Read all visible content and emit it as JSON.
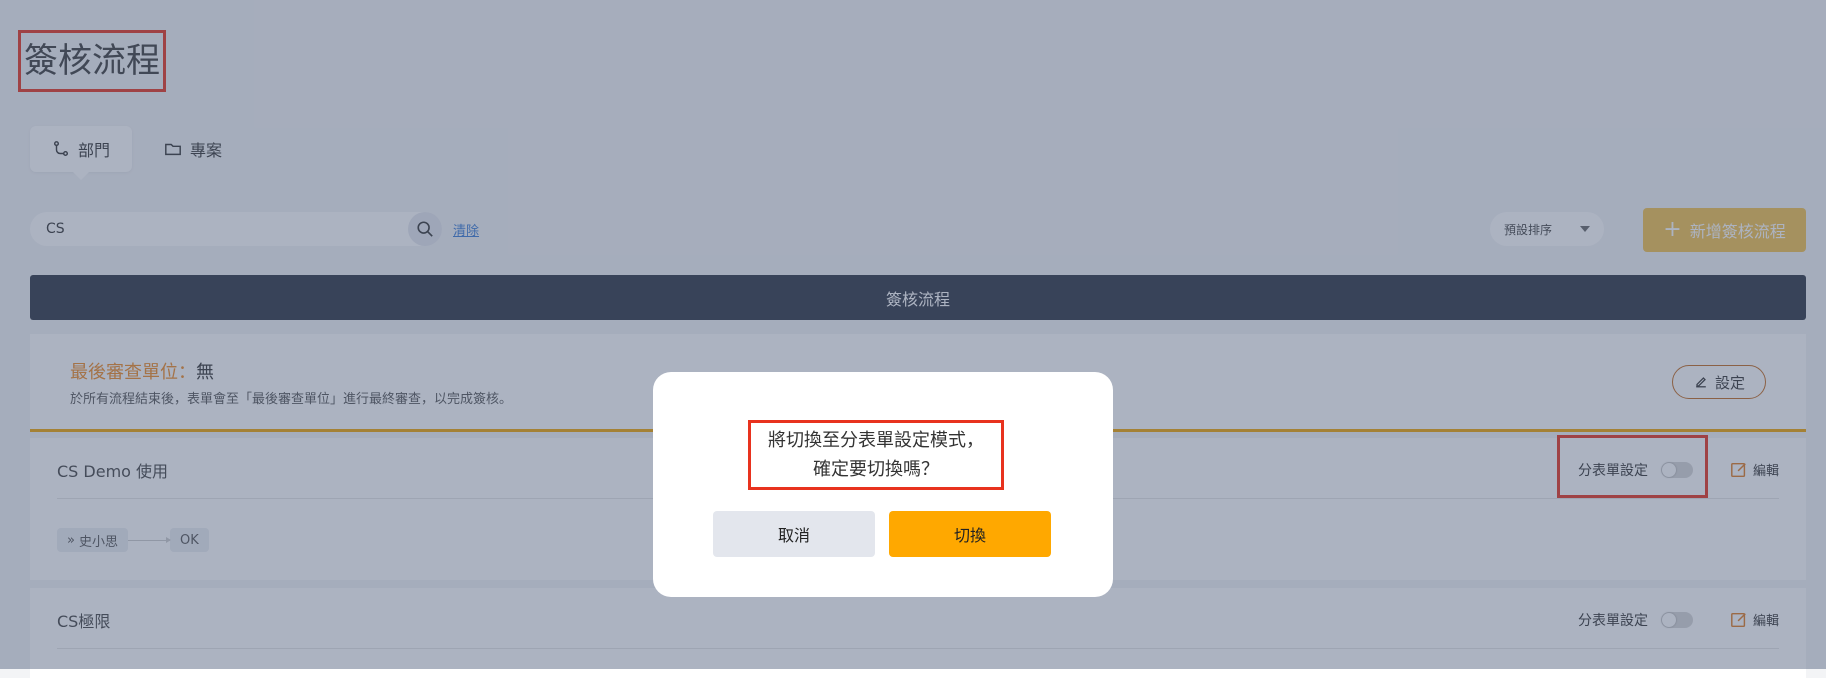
{
  "page": {
    "title": "簽核流程"
  },
  "tabs": [
    {
      "label": "部門",
      "icon": "branch-icon",
      "active": true
    },
    {
      "label": "專案",
      "icon": "folder-icon",
      "active": false
    }
  ],
  "search": {
    "value": "CS",
    "clear_label": "清除"
  },
  "sort": {
    "selected": "預設排序"
  },
  "add_button": {
    "label": "新增簽核流程"
  },
  "table": {
    "header": "簽核流程"
  },
  "final_review": {
    "label": "最後審查單位：",
    "value": "無",
    "description": "於所有流程結束後，表單會至「最後審查單位」進行最終審查，以完成簽核。",
    "set_label": "設定"
  },
  "flows": [
    {
      "name": "CS Demo 使用",
      "split_label": "分表單設定",
      "edit_label": "編輯",
      "steps": [
        "史小思",
        "OK"
      ]
    },
    {
      "name": "CS極限",
      "split_label": "分表單設定",
      "edit_label": "編輯"
    }
  ],
  "modal": {
    "message_line1": "將切換至分表單設定模式，",
    "message_line2": "確定要切換嗎？",
    "cancel_label": "取消",
    "confirm_label": "切換"
  },
  "colors": {
    "accent": "#ffa800",
    "header_bg": "#2d3342",
    "highlight": "#e8321e",
    "label_orange": "#f08a24"
  }
}
